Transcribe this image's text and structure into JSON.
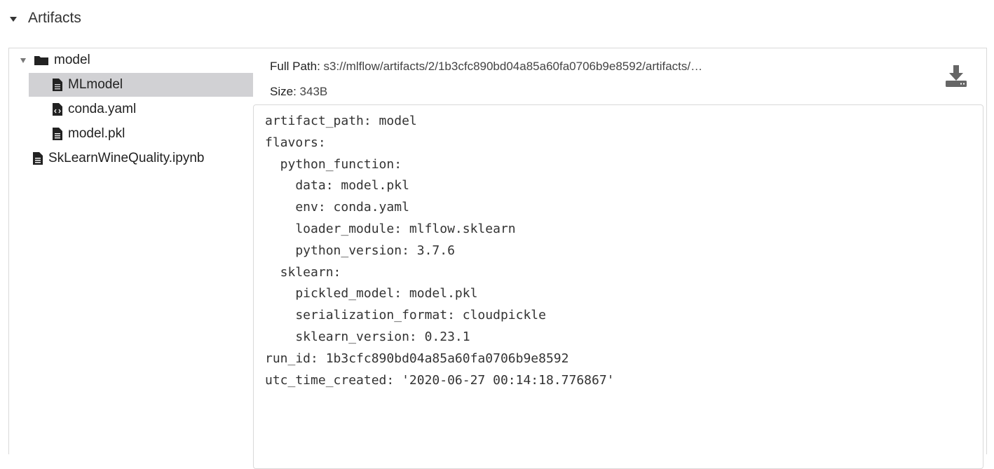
{
  "section": {
    "title": "Artifacts"
  },
  "tree": {
    "items": [
      {
        "label": "model",
        "type": "folder",
        "expanded": true
      },
      {
        "label": "MLmodel",
        "type": "file",
        "selected": true
      },
      {
        "label": "conda.yaml",
        "type": "code-file"
      },
      {
        "label": "model.pkl",
        "type": "file"
      },
      {
        "label": "SkLearnWineQuality.ipynb",
        "type": "file"
      }
    ]
  },
  "details": {
    "full_path_label": "Full Path:",
    "full_path_value": "s3://mlflow/artifacts/2/1b3cfc890bd04a85a60fa0706b9e8592/artifacts/…",
    "size_label": "Size:",
    "size_value": "343B"
  },
  "preview": {
    "lines": [
      "artifact_path: model",
      "flavors:",
      "  python_function:",
      "    data: model.pkl",
      "    env: conda.yaml",
      "    loader_module: mlflow.sklearn",
      "    python_version: 3.7.6",
      "  sklearn:",
      "    pickled_model: model.pkl",
      "    serialization_format: cloudpickle",
      "    sklearn_version: 0.23.1",
      "run_id: 1b3cfc890bd04a85a60fa0706b9e8592",
      "utc_time_created: '2020-06-27 00:14:18.776867'"
    ]
  },
  "colors": {
    "selected_bg": "#d1d1d4",
    "border": "#d9d9d9",
    "text": "#333333"
  }
}
